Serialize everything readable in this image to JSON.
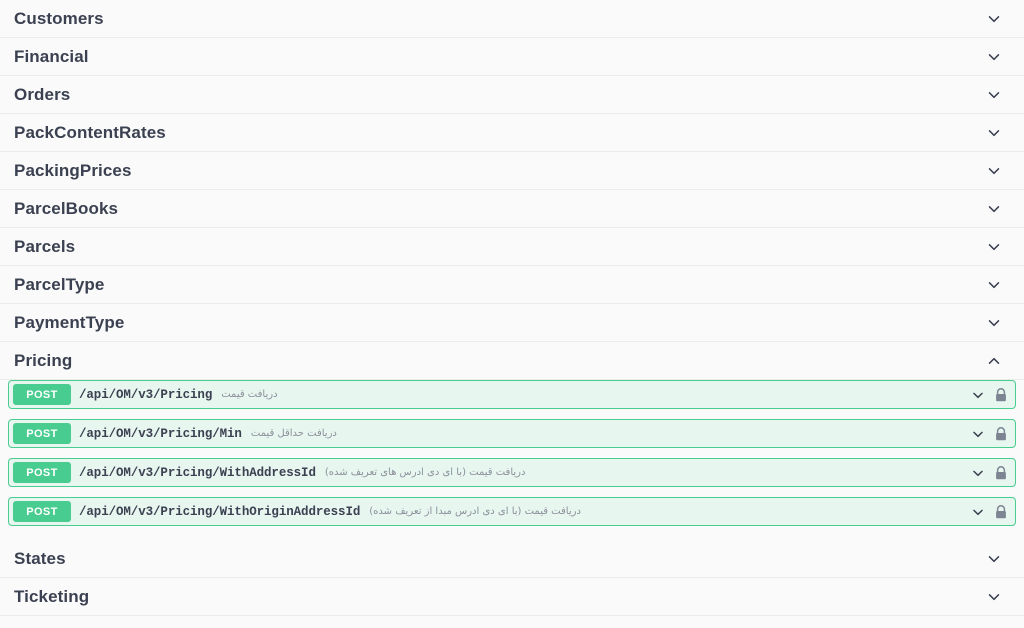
{
  "page": {
    "app": "swagger-ui",
    "background_color": "#fafafa",
    "divider_color": "#ebebeb",
    "title_color": "#3b4151"
  },
  "icons": {
    "collapsed": "chevron-down-icon",
    "expanded": "chevron-up-icon",
    "auth": "lock-icon"
  },
  "colors": {
    "post_badge": "#49cc90",
    "post_row_bg": "#e8f6f0",
    "post_row_border": "#49cc90",
    "lock_gray": "#7d8492",
    "description_gray": "#8a8f99"
  },
  "sections": [
    {
      "id": "customers",
      "label": "Customers",
      "expanded": false,
      "chevron": "chevron-down-icon",
      "operations": []
    },
    {
      "id": "financial",
      "label": "Financial",
      "expanded": false,
      "chevron": "chevron-down-icon",
      "operations": []
    },
    {
      "id": "orders",
      "label": "Orders",
      "expanded": false,
      "chevron": "chevron-down-icon",
      "operations": []
    },
    {
      "id": "packcontentrates",
      "label": "PackContentRates",
      "expanded": false,
      "chevron": "chevron-down-icon",
      "operations": []
    },
    {
      "id": "packingprices",
      "label": "PackingPrices",
      "expanded": false,
      "chevron": "chevron-down-icon",
      "operations": []
    },
    {
      "id": "parcelbooks",
      "label": "ParcelBooks",
      "expanded": false,
      "chevron": "chevron-down-icon",
      "operations": []
    },
    {
      "id": "parcels",
      "label": "Parcels",
      "expanded": false,
      "chevron": "chevron-down-icon",
      "operations": []
    },
    {
      "id": "parceltype",
      "label": "ParcelType",
      "expanded": false,
      "chevron": "chevron-down-icon",
      "operations": []
    },
    {
      "id": "paymenttype",
      "label": "PaymentType",
      "expanded": false,
      "chevron": "chevron-down-icon",
      "operations": []
    },
    {
      "id": "pricing",
      "label": "Pricing",
      "expanded": true,
      "chevron": "chevron-up-icon",
      "operations": [
        {
          "method": "POST",
          "path": "/api/OM/v3/Pricing",
          "description": "دریافت قیمت",
          "locked": true,
          "chevron": "chevron-down-icon"
        },
        {
          "method": "POST",
          "path": "/api/OM/v3/Pricing/Min",
          "description": "دریافت حداقل قیمت",
          "locked": true,
          "chevron": "chevron-down-icon"
        },
        {
          "method": "POST",
          "path": "/api/OM/v3/Pricing/WithAddressId",
          "description": "دریافت قیمت (با آی دی آدرس های تعریف شده)",
          "locked": true,
          "chevron": "chevron-down-icon"
        },
        {
          "method": "POST",
          "path": "/api/OM/v3/Pricing/WithOriginAddressId",
          "description": "دریافت قیمت (با آی دی آدرس مبدا از تعریف شده)",
          "locked": true,
          "chevron": "chevron-down-icon"
        }
      ]
    },
    {
      "id": "states",
      "label": "States",
      "expanded": false,
      "chevron": "chevron-down-icon",
      "operations": []
    },
    {
      "id": "ticketing",
      "label": "Ticketing",
      "expanded": false,
      "chevron": "chevron-down-icon",
      "operations": []
    }
  ]
}
